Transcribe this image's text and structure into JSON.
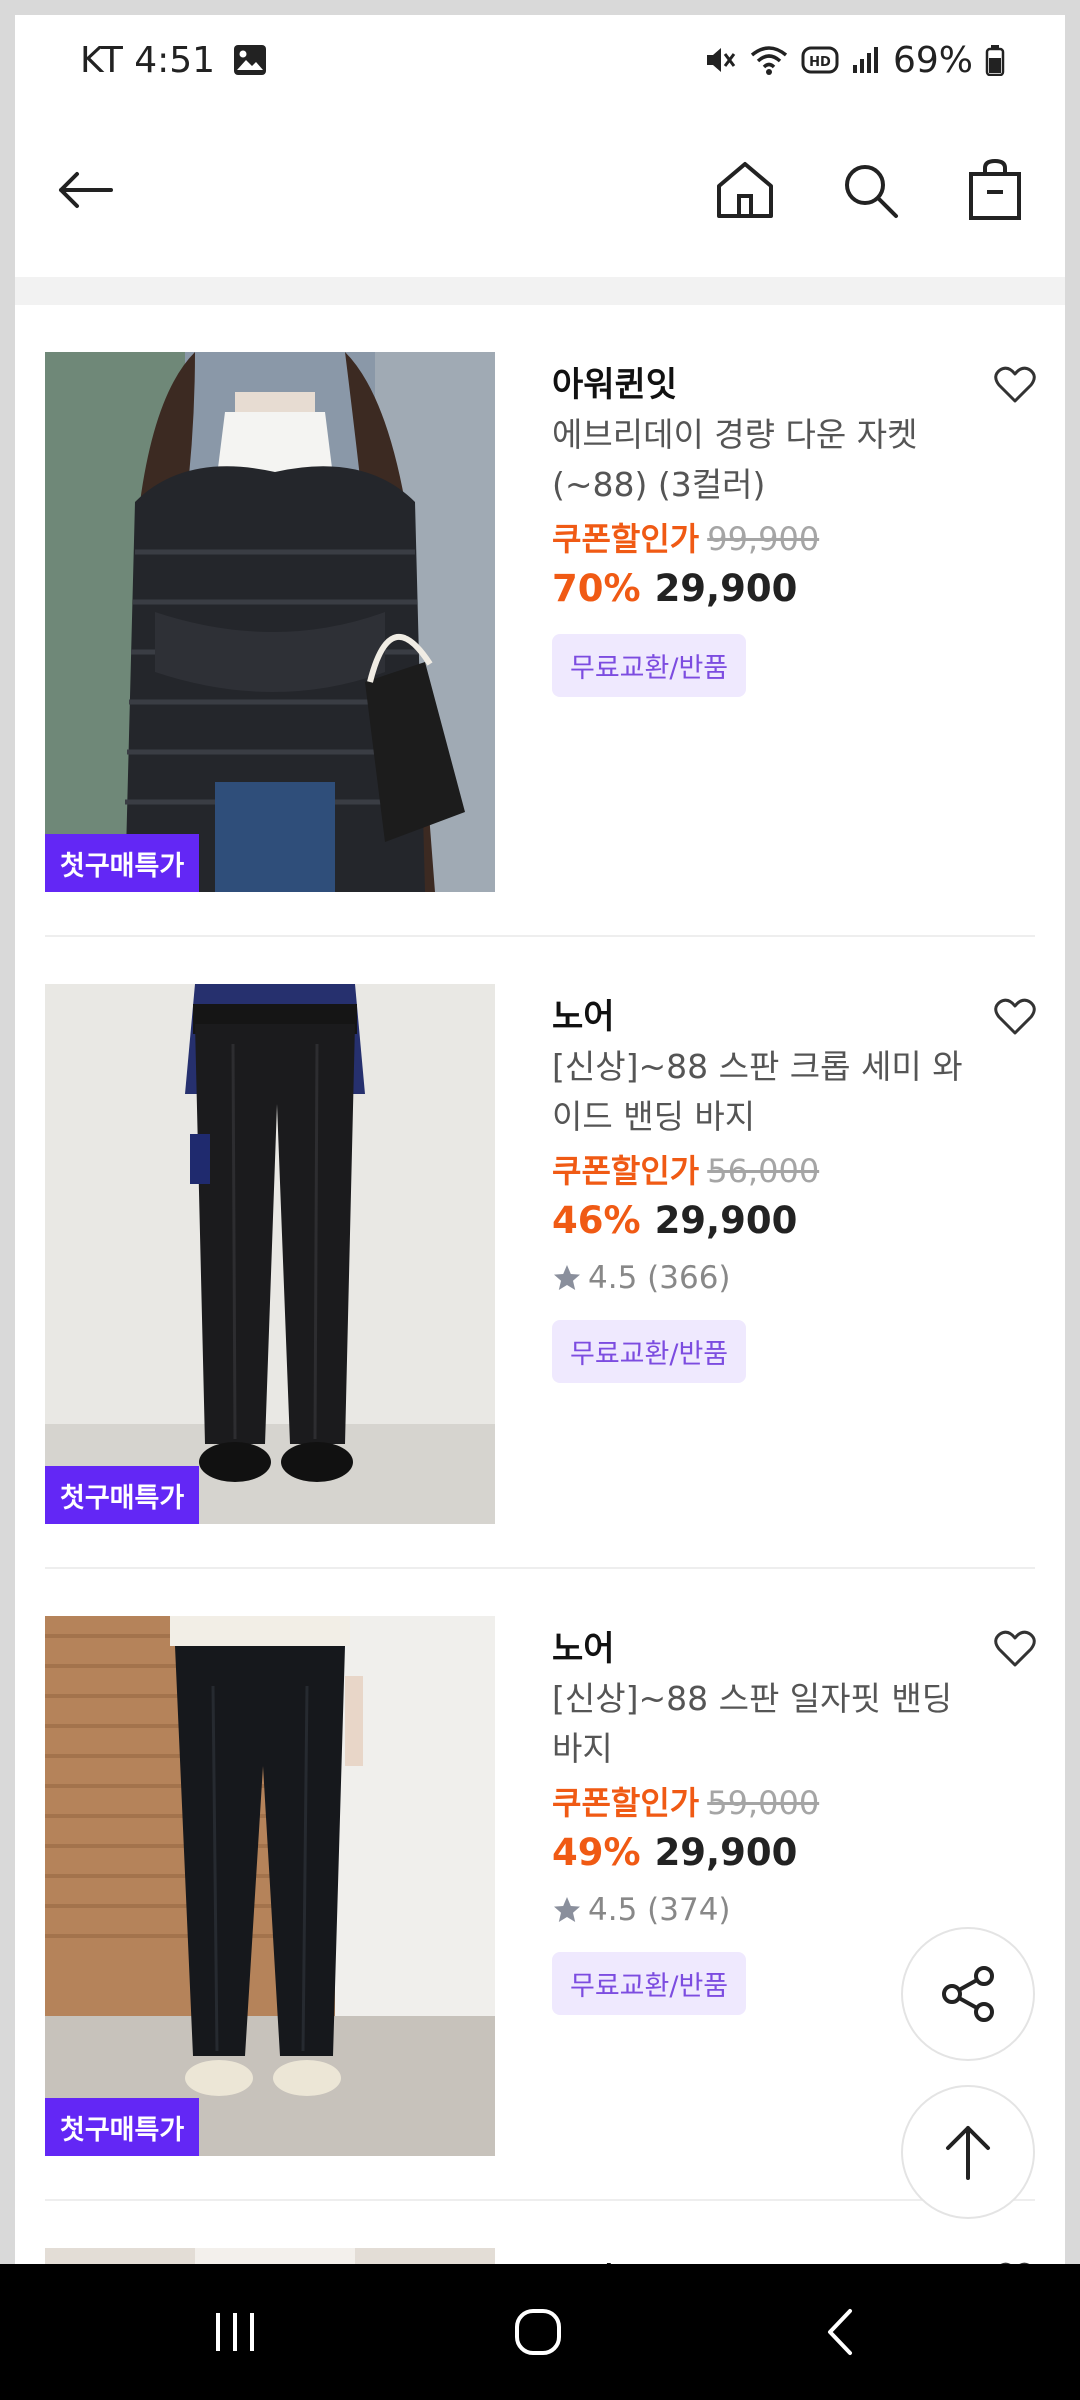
{
  "status": {
    "carrier_time": "KT 4:51",
    "battery": "69%"
  },
  "products": [
    {
      "brand": "아워퀸잇",
      "name": "에브리데이 경량 다운 자켓 (~88) (3컬러)",
      "coupon_label": "쿠폰할인가",
      "original_price": "99,900",
      "discount": "70%",
      "price": "29,900",
      "rating": "",
      "tag": "무료교환/반품",
      "badge": "첫구매특가"
    },
    {
      "brand": "노어",
      "name": "[신상]~88 스판 크롭 세미 와이드 밴딩 바지",
      "coupon_label": "쿠폰할인가",
      "original_price": "56,000",
      "discount": "46%",
      "price": "29,900",
      "rating": "4.5 (366)",
      "tag": "무료교환/반품",
      "badge": "첫구매특가"
    },
    {
      "brand": "노어",
      "name": "[신상]~88 스판 일자핏 밴딩 바지",
      "coupon_label": "쿠폰할인가",
      "original_price": "59,000",
      "discount": "49%",
      "price": "29,900",
      "rating": "4.5 (374)",
      "tag": "무료교환/반품",
      "badge": "첫구매특가"
    },
    {
      "brand": "노어"
    }
  ],
  "icons": {
    "back": "arrow-left-icon",
    "home": "home-icon",
    "search": "search-icon",
    "bag": "shopping-bag-icon",
    "heart": "heart-outline-icon",
    "share": "share-icon",
    "top": "arrow-up-icon"
  },
  "colors": {
    "accent_orange": "#f05a14",
    "badge_purple": "#6327f5",
    "tag_bg": "#efe9fe",
    "tag_text": "#7c4ce0"
  }
}
